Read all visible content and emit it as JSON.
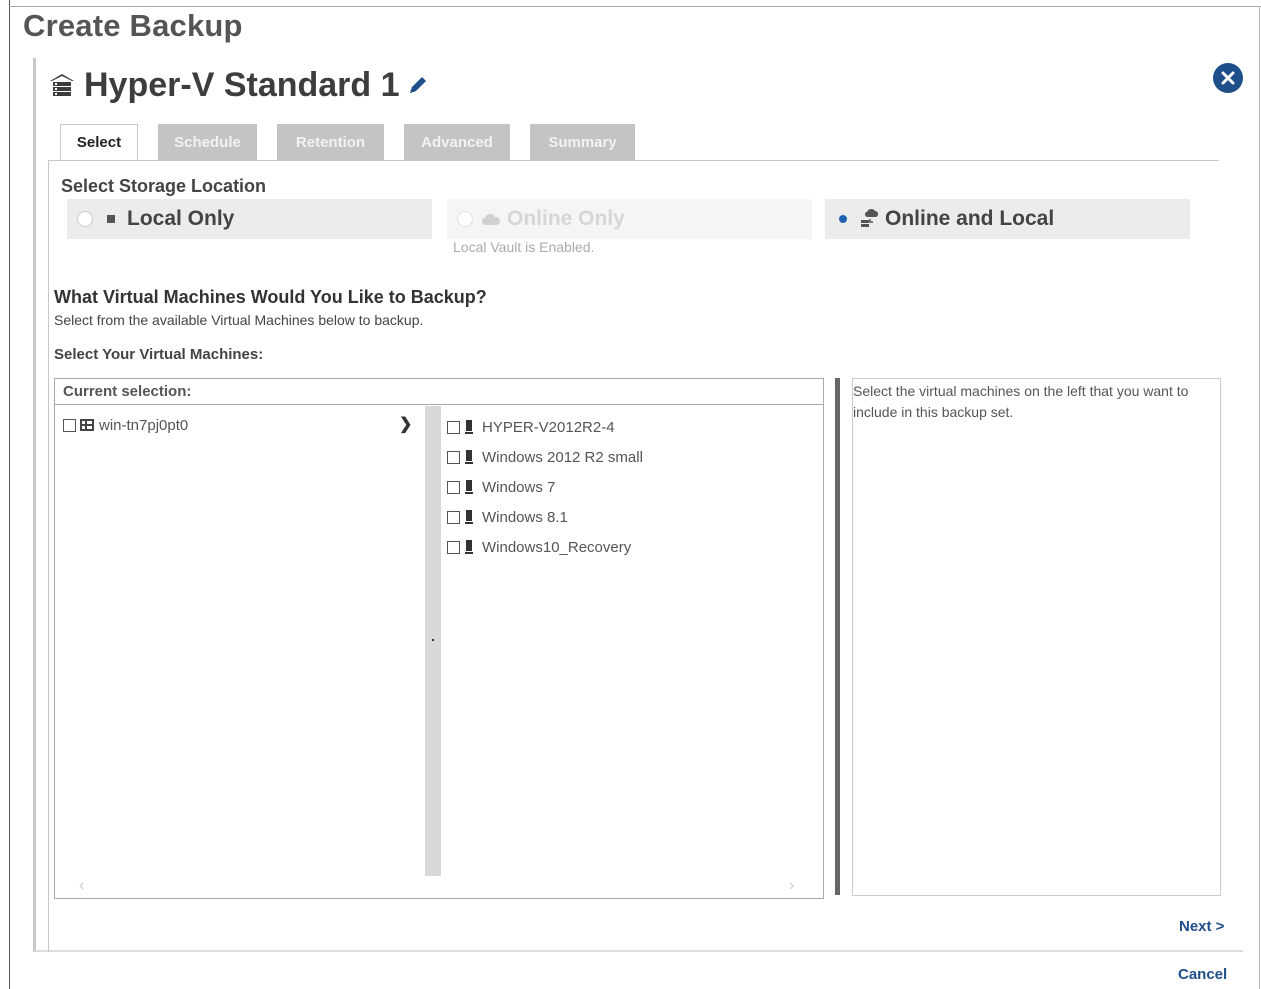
{
  "page": {
    "title": "Create Backup"
  },
  "backup_set": {
    "name": "Hyper-V Standard 1",
    "icon": "hyperv-server-icon",
    "edit_icon": "pencil-icon"
  },
  "tabs": [
    {
      "label": "Select",
      "active": true
    },
    {
      "label": "Schedule",
      "active": false
    },
    {
      "label": "Retention",
      "active": false
    },
    {
      "label": "Advanced",
      "active": false
    },
    {
      "label": "Summary",
      "active": false
    }
  ],
  "storage": {
    "label": "Select Storage Location",
    "options": [
      {
        "label": "Local Only",
        "icon": "disk-icon",
        "selected": false,
        "enabled": true
      },
      {
        "label": "Online Only",
        "icon": "cloud-icon",
        "selected": false,
        "enabled": false,
        "note": "Local Vault is Enabled."
      },
      {
        "label": "Online and Local",
        "icon": "cloud-local-icon",
        "selected": true,
        "enabled": true
      }
    ]
  },
  "vm_section": {
    "question": "What Virtual Machines Would You Like to Backup?",
    "subtitle": "Select from the available Virtual Machines below to backup.",
    "select_label": "Select Your Virtual Machines:",
    "current_selection_label": "Current selection:",
    "host": {
      "label": "win-tn7pj0pt0",
      "checked": false
    },
    "vms": [
      {
        "label": "HYPER-V2012R2-4",
        "checked": false
      },
      {
        "label": "Windows 2012 R2 small",
        "checked": false
      },
      {
        "label": "Windows 7",
        "checked": false
      },
      {
        "label": "Windows 8.1",
        "checked": false
      },
      {
        "label": "Windows10_Recovery",
        "checked": false
      }
    ],
    "help_text": "Select the virtual machines on the left that you want to include in this backup set."
  },
  "footer": {
    "next_label": "Next >",
    "cancel_label": "Cancel"
  },
  "colors": {
    "accent": "#1f4f8b",
    "radio_selected": "#1f63b0",
    "tab_inactive": "#c4c4c4"
  }
}
